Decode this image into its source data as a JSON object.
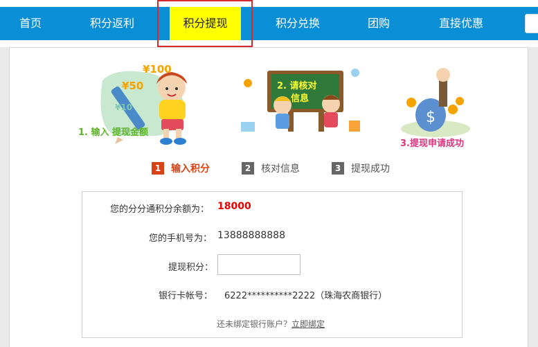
{
  "nav": {
    "items": [
      {
        "label": "首页"
      },
      {
        "label": "积分返利"
      },
      {
        "label": "积分提现"
      },
      {
        "label": "积分兑换"
      },
      {
        "label": "团购"
      },
      {
        "label": "直接优惠"
      }
    ],
    "active_index": 2
  },
  "illustrations": [
    {
      "caption": "1. 输入 提现金额",
      "labels": [
        "¥100",
        "¥50",
        "¥10"
      ],
      "caption_color": "#5fb52a"
    },
    {
      "caption": "2. 请核对信息",
      "board_text": [
        "2. 请核对",
        "信息"
      ],
      "caption_color": "#ffff33"
    },
    {
      "caption": "3.提现申请成功",
      "caption_color": "#e0337f"
    }
  ],
  "steps": [
    {
      "number": "1",
      "label": "输入积分",
      "active": true
    },
    {
      "number": "2",
      "label": "核对信息",
      "active": false
    },
    {
      "number": "3",
      "label": "提现成功",
      "active": false
    }
  ],
  "form": {
    "balance_label": "您的分分通积分余额为：",
    "balance_value": "18000",
    "phone_label": "您的手机号为：",
    "phone_value": "13888888888",
    "points_label": "提现积分：",
    "points_value": "",
    "points_placeholder": "",
    "bank_label": "银行卡帐号：",
    "bank_value": "6222**********2222（珠海农商银行）",
    "hint_text": "还未绑定银行账户？",
    "bind_link": "立即绑定"
  },
  "colors": {
    "nav_bg": "#0a8fd6",
    "nav_active_bg": "#ffff00",
    "highlight_border": "#d8292f",
    "step_active": "#d84316",
    "step_inactive": "#666666",
    "amount": "#e60000"
  }
}
